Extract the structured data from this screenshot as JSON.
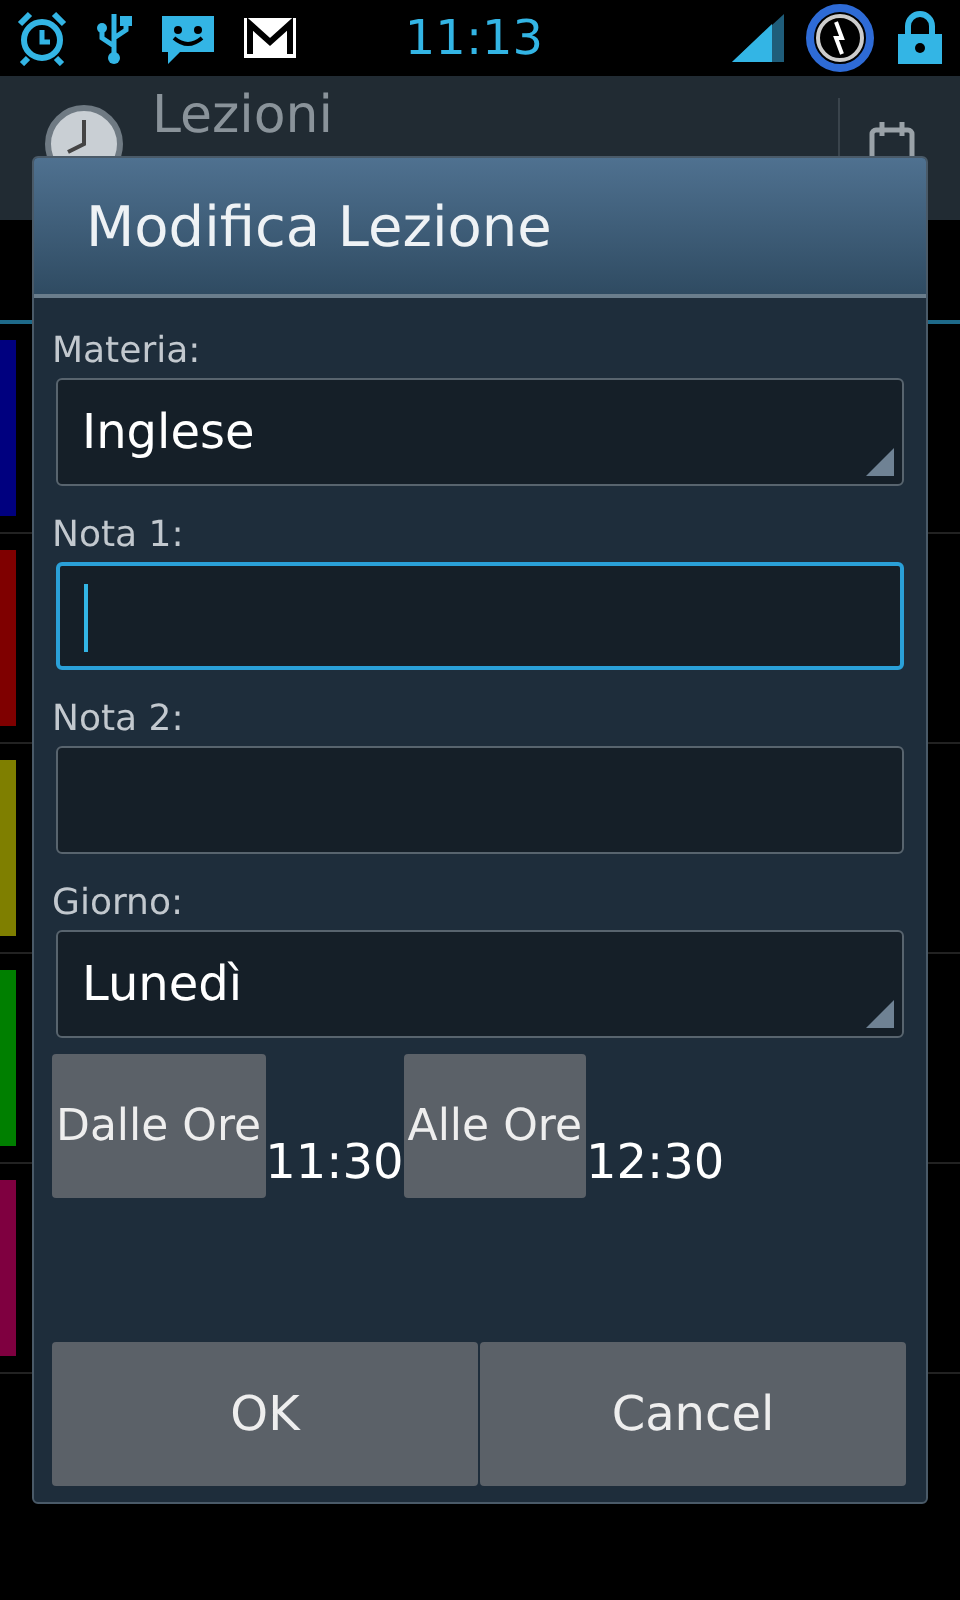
{
  "status_bar": {
    "time": "11:13"
  },
  "app_bar": {
    "title": "Lezioni"
  },
  "lessons": [
    {
      "color": "#00007f"
    },
    {
      "color": "#7f0000"
    },
    {
      "color": "#7f7f00"
    },
    {
      "color": "#007f00"
    },
    {
      "color": "#7f0040"
    }
  ],
  "dialog": {
    "title": "Modifica Lezione",
    "fields": [
      {
        "kind": "spinner",
        "label": "Materia:",
        "value": "Inglese"
      },
      {
        "kind": "input",
        "label": "Nota 1:",
        "focused": true
      },
      {
        "kind": "input",
        "label": "Nota 2:",
        "focused": false
      },
      {
        "kind": "spinner",
        "label": "Giorno:",
        "value": "Lunedì"
      }
    ],
    "times": [
      {
        "button": "Dalle Ore",
        "value": "11:30"
      },
      {
        "button": "Alle Ore",
        "value": "12:30"
      }
    ],
    "buttons": [
      "OK",
      "Cancel"
    ]
  }
}
